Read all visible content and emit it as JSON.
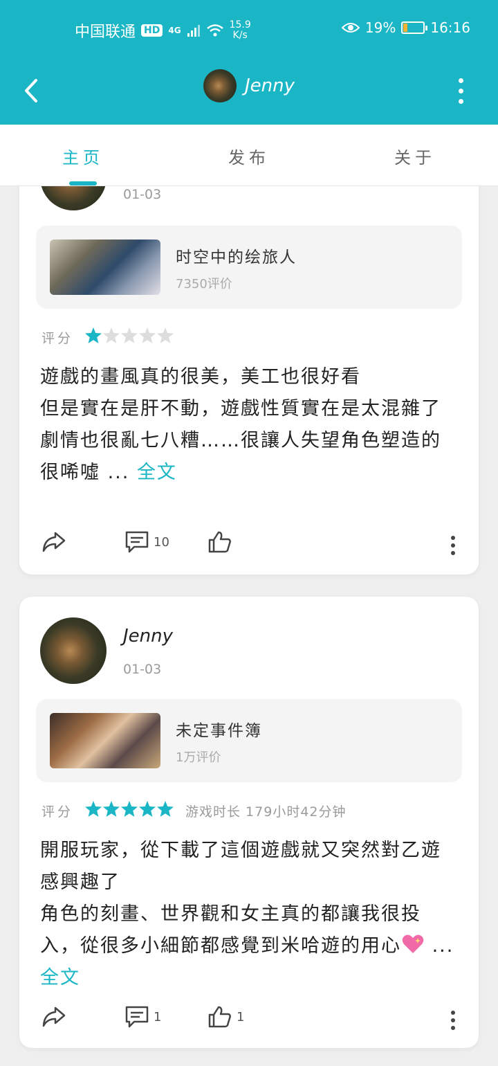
{
  "status_bar": {
    "carrier": "中国联通",
    "hd": "HD",
    "network": "4G",
    "speed_value": "15.9",
    "speed_unit": "K/s",
    "battery": "19%",
    "battery_level": 0.19,
    "time": "16:16"
  },
  "header": {
    "title": "Jenny"
  },
  "tabs": [
    {
      "label": "主页",
      "active": true
    },
    {
      "label": "发布",
      "active": false
    },
    {
      "label": "关于",
      "active": false
    }
  ],
  "posts": [
    {
      "author": "",
      "date": "01-03",
      "game": {
        "name": "时空中的绘旅人",
        "reviews": "7350评价"
      },
      "rating_label": "评分",
      "stars": 1,
      "playtime": "",
      "text": [
        "遊戲的畫風真的很美，美工也很好看",
        "但是實在是肝不動，遊戲性質實在是太混雜了",
        "劇情也很亂七八糟……很讓人失望角色塑造的很唏噓"
      ],
      "more_ellipsis": "...",
      "more": "全文",
      "comments": "10",
      "likes": ""
    },
    {
      "author": "Jenny",
      "date": "01-03",
      "game": {
        "name": "未定事件簿",
        "reviews": "1万评价"
      },
      "rating_label": "评分",
      "stars": 5,
      "playtime": "游戏时长 179小时42分钟",
      "text": [
        "開服玩家，從下載了這個遊戲就又突然對乙遊感興趣了",
        "角色的刻畫、世界觀和女主真的都讓我很投入，從很多小細節都感覺到米哈遊的用心"
      ],
      "more_ellipsis": "...",
      "more": "全文",
      "comments": "1",
      "likes": "1"
    }
  ],
  "colors": {
    "accent": "#1ab6c6",
    "star_on": "#1ab6c6",
    "star_off": "#dddddd"
  }
}
